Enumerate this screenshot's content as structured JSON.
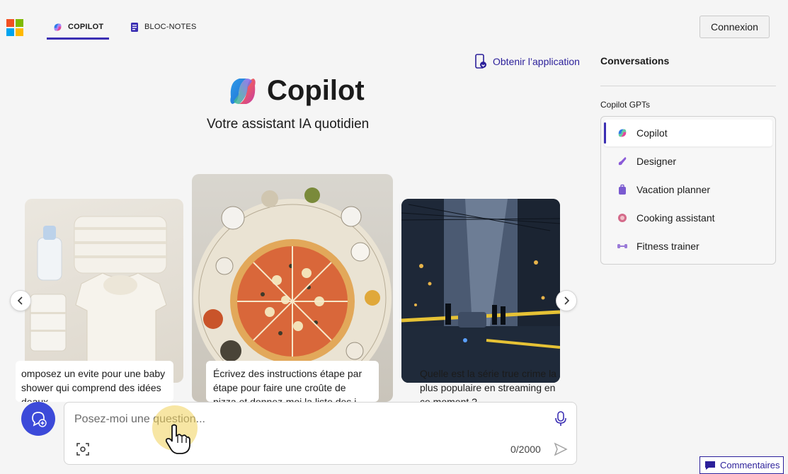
{
  "header": {
    "logo": "microsoft-logo",
    "tabs": [
      {
        "label": "COPILOT",
        "icon": "copilot-icon",
        "active": true
      },
      {
        "label": "BLOC-NOTES",
        "icon": "notebook-icon",
        "active": false
      }
    ],
    "login_label": "Connexion"
  },
  "main": {
    "get_app_label": "Obtenir l’application",
    "title": "Copilot",
    "subtitle": "Votre assistant IA quotidien",
    "cards": [
      {
        "caption": "omposez un evite pour une baby shower qui comprend des idées deaux",
        "image": "baby-clothes-image"
      },
      {
        "caption": "Écrivez des instructions étape par étape pour faire une croûte de pizza et donnez-moi la liste des i",
        "image": "pizza-image"
      },
      {
        "caption": "Quelle est la série true crime la plus populaire en streaming en ce moment ?",
        "image": "crime-scene-image"
      }
    ],
    "composer": {
      "placeholder": "Posez-moi une question...",
      "counter": "0/2000"
    }
  },
  "sidebar": {
    "title": "Conversations",
    "gpts_label": "Copilot GPTs",
    "items": [
      {
        "label": "Copilot",
        "icon": "copilot-icon",
        "active": true
      },
      {
        "label": "Designer",
        "icon": "designer-icon",
        "active": false
      },
      {
        "label": "Vacation planner",
        "icon": "suitcase-icon",
        "active": false
      },
      {
        "label": "Cooking assistant",
        "icon": "cooking-icon",
        "active": false
      },
      {
        "label": "Fitness trainer",
        "icon": "dumbbell-icon",
        "active": false
      }
    ]
  },
  "feedback_label": "Commentaires",
  "colors": {
    "accent": "#3b2fb3",
    "link": "#2b1f9a",
    "new_chat": "#3c4ad9",
    "background": "#f5f5f5"
  }
}
